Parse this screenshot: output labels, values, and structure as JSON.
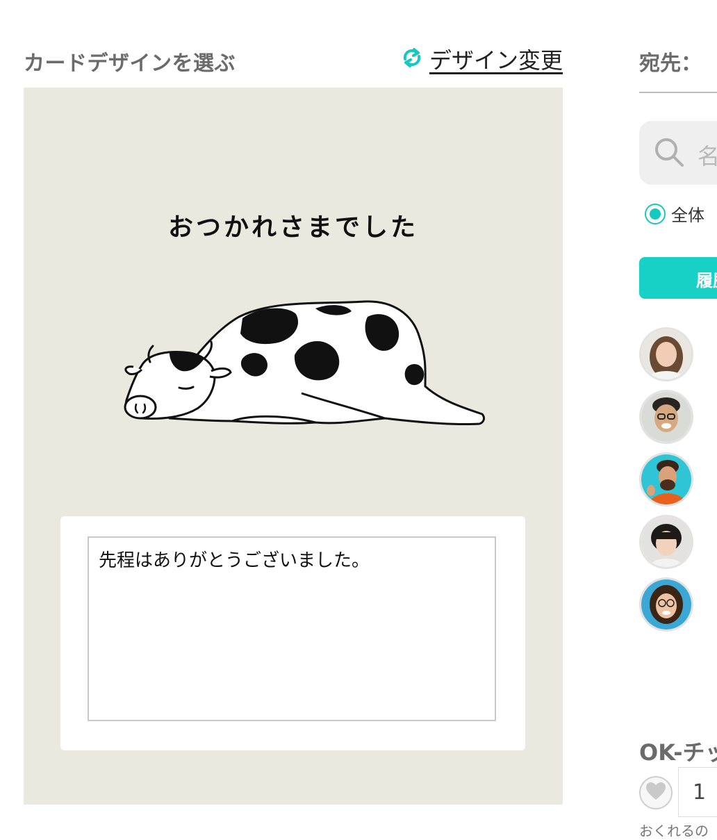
{
  "header": {
    "left_title": "カードデザインを選ぶ",
    "change_design_label": "デザイン変更",
    "change_icon": "refresh-icon",
    "accent_color": "#17c8c0"
  },
  "card": {
    "heading": "おつかれさまでした",
    "background": "#eae9df",
    "illustration": "sleeping-cow-illustration",
    "message": "先程はありがとうございました。"
  },
  "recipient": {
    "label": "宛先：",
    "search_placeholder": "名",
    "radio_all_label": "全体",
    "history_button_label": "履歴",
    "avatars": [
      "avatar-1",
      "avatar-2",
      "avatar-3",
      "avatar-4",
      "avatar-5"
    ]
  },
  "ok_section": {
    "title": "OK-チッ",
    "quantity": "1",
    "footer_note": "おくれるの"
  }
}
